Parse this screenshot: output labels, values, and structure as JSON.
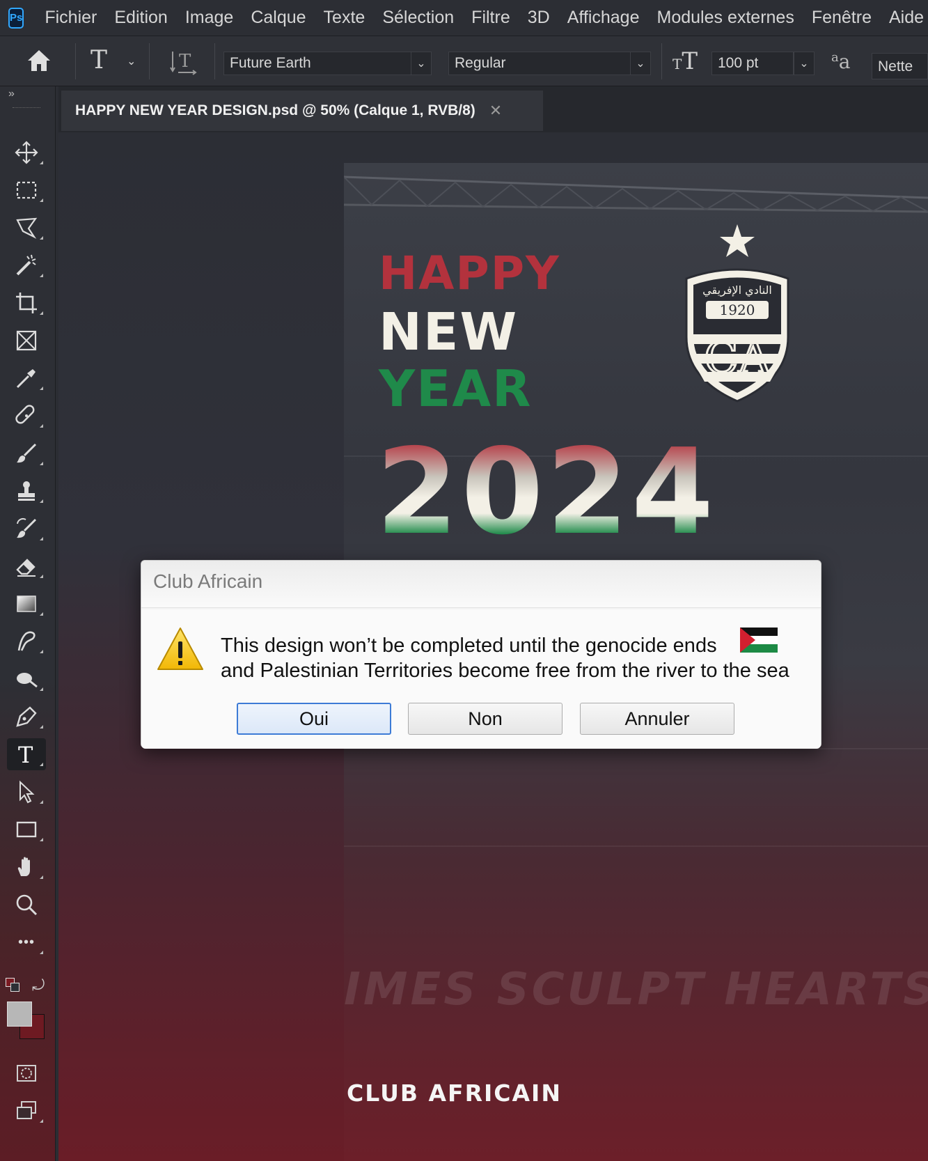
{
  "app": {
    "logo": "Ps",
    "menu": [
      "Fichier",
      "Edition",
      "Image",
      "Calque",
      "Texte",
      "Sélection",
      "Filtre",
      "3D",
      "Affichage",
      "Modules externes",
      "Fenêtre",
      "Aide"
    ]
  },
  "options_bar": {
    "font_family": "Future Earth",
    "font_style": "Regular",
    "font_size": "100 pt",
    "antialias_glyph": "a",
    "antialias_glyph_small": "a",
    "antialias_value": "Nette",
    "type_tool_glyph": "T",
    "size_glyph": "T"
  },
  "document": {
    "tab_title": "HAPPY NEW YEAR DESIGN.psd @ 50% (Calque 1, RVB/8)",
    "close_glyph": "✕"
  },
  "toolbar": {
    "collapse_glyph": "»",
    "more_glyph": "•••",
    "tools": [
      "move-icon",
      "marquee-icon",
      "lasso-icon",
      "magic-wand-icon",
      "crop-icon",
      "frame-icon",
      "eyedropper-icon",
      "healing-icon",
      "brush-icon",
      "stamp-icon",
      "history-brush-icon",
      "eraser-icon",
      "gradient-icon",
      "smudge-icon",
      "dodge-icon",
      "pen-icon",
      "type-icon",
      "path-select-icon",
      "rectangle-icon",
      "hand-icon",
      "zoom-icon",
      "more-tools-icon",
      "default-colors-icon",
      "swap-colors-icon",
      "color-swatches-icon",
      "quick-mask-icon",
      "screen-mode-icon"
    ],
    "active_tool": "type-icon",
    "foreground_color": "#b7b7b7",
    "background_color": "#6e1a22"
  },
  "artwork": {
    "happy": "HAPPY",
    "new": "NEW",
    "year": "YEAR",
    "year_number": "2024",
    "crest_arabic": "النادي الإفريقي",
    "crest_year": "1920",
    "crest_monogram": "CA",
    "banner_text": "IMES SCULPT HEARTS,FO",
    "footer": "CLUB AFRICAIN",
    "colors": {
      "red": "#b3323d",
      "cream": "#f3f0e6",
      "green": "#1f8a4a"
    }
  },
  "dialog": {
    "title": "Club Africain",
    "message_line1": "This design won’t be completed until the genocide ends",
    "message_line2": "and Palestinian Territories become free from the river to the sea",
    "buttons": {
      "yes": "Oui",
      "no": "Non",
      "cancel": "Annuler"
    },
    "default_button": "yes"
  }
}
